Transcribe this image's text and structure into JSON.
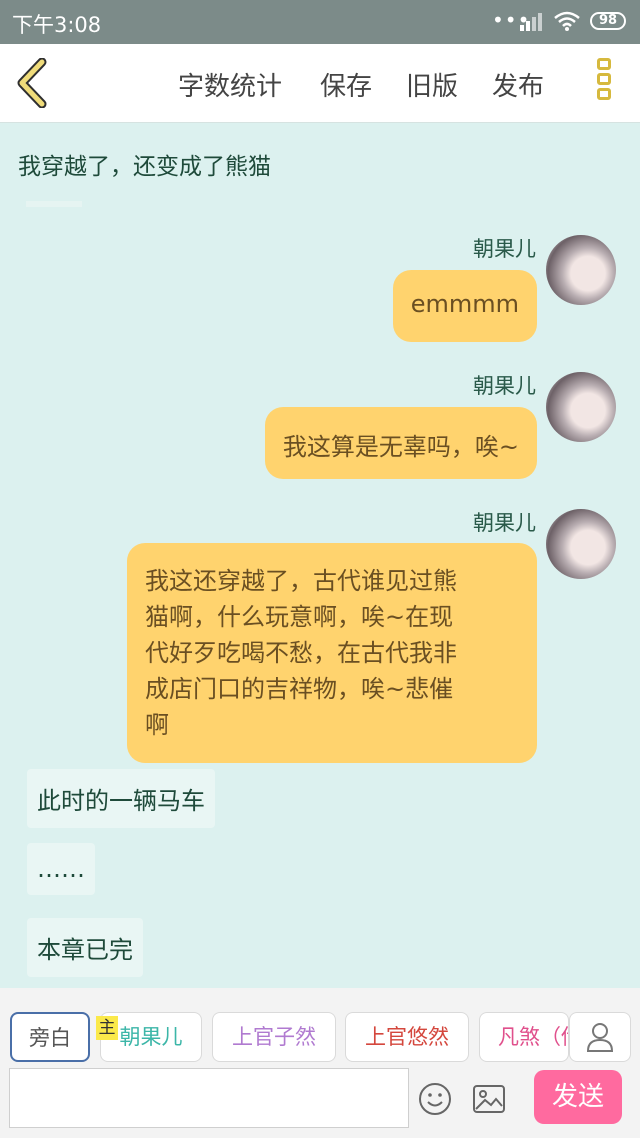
{
  "status_bar": {
    "time": "下午3:08",
    "battery": "98"
  },
  "toolbar": {
    "word_count": "字数统计",
    "save": "保存",
    "old_version": "旧版",
    "publish": "发布"
  },
  "chapter": {
    "title": "我穿越了，还变成了熊猫"
  },
  "messages": [
    {
      "name": "朝果儿",
      "text": "emmmm"
    },
    {
      "name": "朝果儿",
      "text": "我这算是无辜吗，唉~"
    },
    {
      "name": "朝果儿",
      "lines": [
        "我这还穿越了，古代谁见过熊",
        "猫啊，什么玩意啊，唉~在现",
        "代好歹吃喝不愁，在古代我非",
        "成店门口的吉祥物，唉~悲催",
        "啊"
      ]
    }
  ],
  "narration": [
    {
      "text": "此时的一辆马车"
    },
    {
      "text": "……"
    },
    {
      "text": "本章已完"
    }
  ],
  "characters": {
    "narrator": "旁白",
    "host_tag": "主",
    "items": [
      {
        "label": "朝果儿",
        "color": "#3cb6a8"
      },
      {
        "label": "上官子然",
        "color": "#b07ad0"
      },
      {
        "label": "上官悠然",
        "color": "#d4473d"
      },
      {
        "label": "凡煞（传",
        "color": "#e0508c"
      }
    ]
  },
  "composer": {
    "send": "发送"
  },
  "colors": {
    "bubble": "#ffd36e",
    "accent": "#ff6a9f",
    "background": "#dcf1ef"
  }
}
